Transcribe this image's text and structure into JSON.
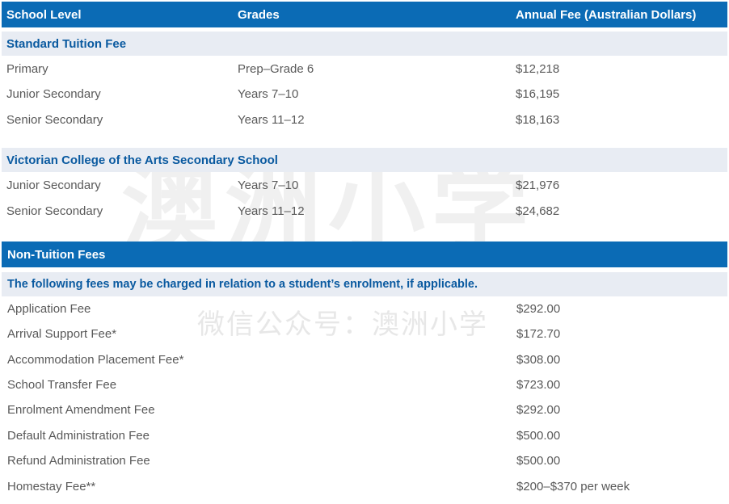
{
  "header": {
    "col1": "School Level",
    "col2": "Grades",
    "col3": "Annual Fee (Australian Dollars)"
  },
  "tuition": {
    "section_title": "Standard Tuition Fee",
    "rows": [
      {
        "level": "Primary",
        "grades": "Prep–Grade 6",
        "fee": "$12,218"
      },
      {
        "level": "Junior Secondary",
        "grades": "Years 7–10",
        "fee": "$16,195"
      },
      {
        "level": "Senior Secondary",
        "grades": "Years 11–12",
        "fee": "$18,163"
      }
    ]
  },
  "vca": {
    "section_title": "Victorian College of the Arts Secondary School",
    "rows": [
      {
        "level": "Junior Secondary",
        "grades": "Years 7–10",
        "fee": "$21,976"
      },
      {
        "level": "Senior Secondary",
        "grades": "Years 11–12",
        "fee": "$24,682"
      }
    ]
  },
  "non_tuition": {
    "title": "Non-Tuition Fees",
    "note": "The following fees may be charged in relation to a student’s enrolment, if applicable.",
    "rows": [
      {
        "name": "Application Fee",
        "fee": "$292.00"
      },
      {
        "name": "Arrival Support Fee*",
        "fee": "$172.70"
      },
      {
        "name": "Accommodation Placement Fee*",
        "fee": "$308.00"
      },
      {
        "name": "School Transfer Fee",
        "fee": "$723.00"
      },
      {
        "name": "Enrolment Amendment Fee",
        "fee": "$292.00"
      },
      {
        "name": "Default Administration Fee",
        "fee": "$500.00"
      },
      {
        "name": "Refund Administration Fee",
        "fee": "$500.00"
      },
      {
        "name": "Homestay Fee**",
        "fee": "$200–$370 per week"
      }
    ]
  },
  "watermark": {
    "large": "澳洲小学",
    "small": "微信公众号：澳洲小学"
  },
  "colors": {
    "header_bg": "#0b6bb5",
    "section_bg": "#e8ecf3",
    "section_text": "#0a5aa0",
    "body_text": "#595959"
  }
}
